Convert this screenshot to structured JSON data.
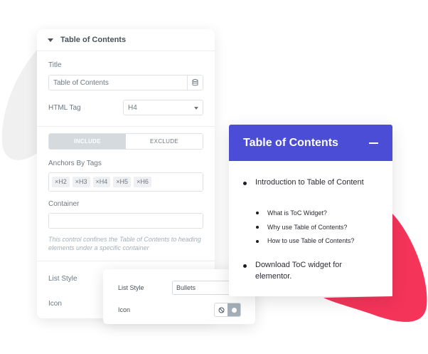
{
  "settings_panel": {
    "header": {
      "title": "Table of Contents"
    },
    "title_field": {
      "label": "Title",
      "value": "Table of Contents"
    },
    "html_tag": {
      "label": "HTML Tag",
      "value": "H4"
    },
    "include_exclude": {
      "include_label": "INCLUDE",
      "exclude_label": "EXCLUDE",
      "active": "INCLUDE"
    },
    "anchors": {
      "label": "Anchors By Tags",
      "tags": [
        "×H2",
        "×H3",
        "×H4",
        "×H5",
        "×H6"
      ]
    },
    "container": {
      "label": "Container",
      "value": "",
      "hint": "This control confines the Table of Contents to heading elements under a specific container"
    },
    "list_style": {
      "label": "List Style"
    },
    "icon": {
      "label": "Icon"
    }
  },
  "popup": {
    "list_style": {
      "label": "List Style",
      "value": "Bullets"
    },
    "icon": {
      "label": "Icon",
      "options": [
        "ban-icon",
        "circle-icon"
      ],
      "selected": "circle-icon"
    }
  },
  "toc_widget": {
    "title": "Table of Contents",
    "header_color": "#4b4dd6",
    "toggle_icon": "minus-icon",
    "items": [
      {
        "label": "Introduction to Table of Content",
        "children": [
          "What is ToC Widget?",
          "Why use Table of Contents?",
          "How to use Table of Contents?"
        ]
      },
      {
        "label": "Download ToC widget for elementor.",
        "children": []
      }
    ]
  },
  "colors": {
    "accent_blob": "#f5345a",
    "grey_blob": "#f0f0f1"
  }
}
